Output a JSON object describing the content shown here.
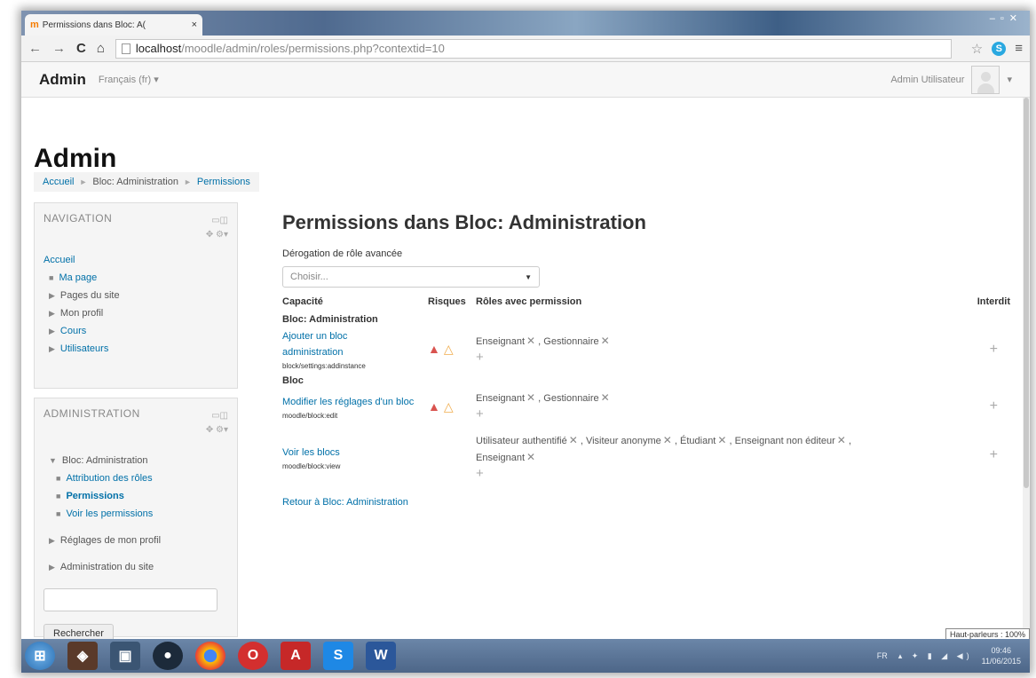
{
  "browser": {
    "tab_title": "Permissions dans Bloc: A(",
    "tab_close": "×",
    "url_host": "localhost",
    "url_path": "/moodle/admin/roles/permissions.php?contextid=10"
  },
  "topnav": {
    "brand": "Admin",
    "language": "Français (fr) ▾",
    "user_name": "Admin Utilisateur",
    "user_caret": "▾"
  },
  "page": {
    "heading": "Admin",
    "breadcrumb": [
      "Accueil",
      "Bloc: Administration",
      "Permissions"
    ]
  },
  "navigation_block": {
    "title": "NAVIGATION",
    "home": "Accueil",
    "items": [
      "Ma page",
      "Pages du site",
      "Mon profil",
      "Cours",
      "Utilisateurs"
    ]
  },
  "admin_block": {
    "title": "ADMINISTRATION",
    "bloc": "Bloc: Administration",
    "sub_items": [
      "Attribution des rôles",
      "Permissions",
      "Voir les permissions"
    ],
    "items": [
      "Réglages de mon profil",
      "Administration du site"
    ],
    "search_button": "Rechercher"
  },
  "main": {
    "title": "Permissions dans Bloc: Administration",
    "advanced_label": "Dérogation de rôle avancée",
    "select_placeholder": "Choisir...",
    "columns": {
      "capability": "Capacité",
      "risks": "Risques",
      "roles": "Rôles avec permission",
      "forbidden": "Interdit"
    },
    "sections": [
      {
        "name": "Bloc: Administration",
        "rows": [
          {
            "capability": "Ajouter un bloc administration",
            "code": "block/settings:addinstance",
            "roles": [
              "Enseignant",
              "Gestionnaire"
            ]
          }
        ]
      },
      {
        "name": "Bloc",
        "rows": [
          {
            "capability": "Modifier les réglages d'un bloc",
            "code": "moodle/block:edit",
            "roles": [
              "Enseignant",
              "Gestionnaire"
            ]
          },
          {
            "capability": "Voir les blocs",
            "code": "moodle/block:view",
            "roles": [
              "Utilisateur authentifié",
              "Visiteur anonyme",
              "Étudiant",
              "Enseignant non éditeur",
              "Enseignant"
            ]
          }
        ]
      }
    ],
    "back_link": "Retour à Bloc: Administration"
  },
  "taskbar": {
    "lang": "FR",
    "time": "09:46",
    "date": "11/06/2015",
    "tooltip": "Haut-parleurs : 100%"
  },
  "icons": {
    "risk_red": "warning-red",
    "risk_yellow": "warning-yellow",
    "remove": "x-icon",
    "add": "plus-icon"
  }
}
